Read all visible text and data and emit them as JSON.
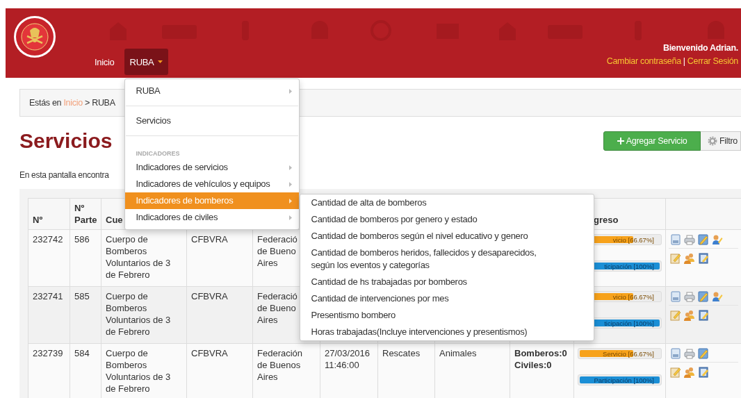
{
  "header": {
    "nav": [
      {
        "label": "Inicio",
        "selected": false,
        "dropdown": false
      },
      {
        "label": "RUBA",
        "selected": true,
        "dropdown": true
      }
    ],
    "welcome": "Bienvenido Adrian.",
    "links": [
      "Cambiar contraseña",
      "Cerrar Sesión"
    ],
    "separator": "|"
  },
  "menu": {
    "items": [
      {
        "kind": "item",
        "label": "RUBA",
        "submenu": true,
        "selected": false
      },
      {
        "kind": "divider"
      },
      {
        "kind": "item",
        "label": "Servicios",
        "submenu": false,
        "selected": false
      },
      {
        "kind": "divider"
      },
      {
        "kind": "header",
        "label": "INDICADORES"
      },
      {
        "kind": "item",
        "label": "Indicadores de servicios",
        "submenu": true,
        "selected": false
      },
      {
        "kind": "item",
        "label": "Indicadores de vehículos y equipos",
        "submenu": true,
        "selected": false
      },
      {
        "kind": "item",
        "label": "Indicadores de bomberos",
        "submenu": true,
        "selected": true,
        "children": [
          "Cantidad de alta de bomberos",
          "Cantidad de bomberos por genero y estado",
          "Cantidad de bomberos según el nivel educativo y genero",
          "Cantidad de bomberos heridos, fallecidos y desaparecidos, según los eventos y categorías",
          "Cantidad de hs trabajadas por bomberos",
          "Cantidad de intervenciones por mes",
          "Presentismo bombero",
          "Horas trabajadas(Incluye intervenciones y presentismos)"
        ]
      },
      {
        "kind": "item",
        "label": "Indicadores de civiles",
        "submenu": true,
        "selected": false
      }
    ]
  },
  "breadcrumb": {
    "prefix": "Estás en",
    "link": "Inicio",
    "rest": "> RUBA"
  },
  "page": {
    "title": "Servicios",
    "description": "En esta pantalla encontra",
    "buttons": [
      {
        "kind": "add",
        "label": "Agregar Servicio"
      },
      {
        "kind": "filter",
        "label": "Filtro"
      }
    ]
  },
  "table": {
    "columns": [
      "Nº",
      "Nº Parte",
      "Cue"
    ],
    "progress_column": "greso",
    "rows": [
      {
        "id": "232742",
        "parte": "586",
        "cuerpo": "Cuerpo de Bomberos Voluntarios de 3 de Febrero",
        "sigla": "CFBVRA",
        "federacion": [
          "Federació",
          "de Bueno",
          "Aires"
        ],
        "servicio": {
          "label": "vicio [66.67%]",
          "level": 0.6667
        },
        "participacion": {
          "label": "ticipación [100%]",
          "level": 1
        },
        "assign_action": true
      },
      {
        "id": "232741",
        "parte": "585",
        "cuerpo": "Cuerpo de Bomberos Voluntarios de 3 de Febrero",
        "sigla": "CFBVRA",
        "federacion": [
          "Federació",
          "de Bueno",
          "Aires"
        ],
        "servicio": {
          "label": "vicio [66.67%]",
          "level": 0.6667
        },
        "participacion": {
          "label": "ticipación [100%]",
          "level": 1
        },
        "assign_action": true
      },
      {
        "id": "232739",
        "parte": "584",
        "cuerpo": "Cuerpo de Bomberos Voluntarios de 3 de Febrero",
        "sigla": "CFBVRA",
        "federacion": [
          "Federación",
          "de Buenos",
          "Aires"
        ],
        "fecha": [
          "27/03/2016",
          "11:46:00"
        ],
        "tipo": "Rescates",
        "subtipo": "Animales",
        "victimas": [
          "Bomberos:0",
          "Civiles:0"
        ],
        "servicio": {
          "label": "Servicio [66.67%]",
          "level": 0.6667
        },
        "participacion": {
          "label": "Participación [100%]",
          "level": 1
        },
        "assign_action": false
      }
    ]
  }
}
